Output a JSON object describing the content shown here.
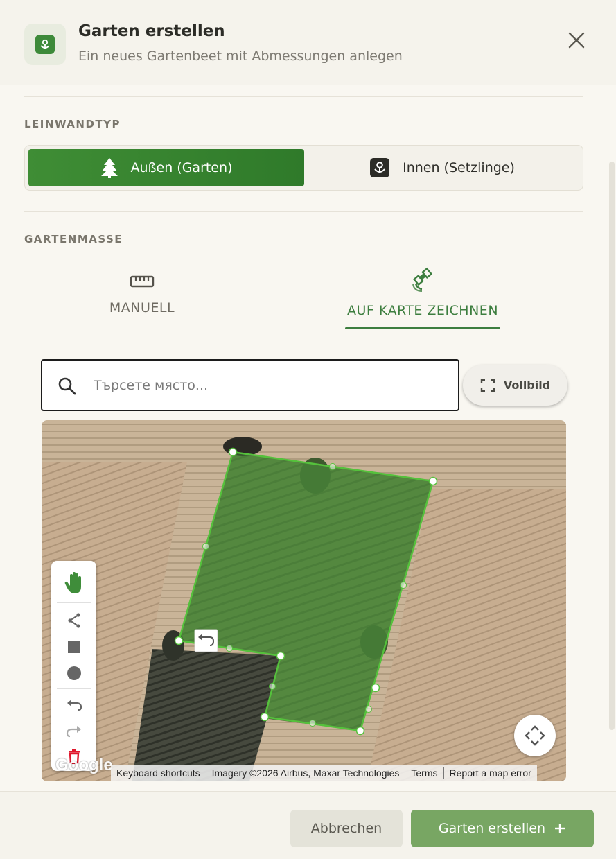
{
  "dialog": {
    "title": "Garten erstellen",
    "subtitle": "Ein neues Gartenbeet mit Abmessungen anlegen",
    "header_icon": "flower-icon",
    "close_icon": "close-icon"
  },
  "canvas_type": {
    "label": "LEINWANDTYP",
    "options": [
      {
        "label": "Außen (Garten)",
        "icon": "tree-icon",
        "selected": true
      },
      {
        "label": "Innen (Setzlinge)",
        "icon": "seedling-icon",
        "selected": false
      }
    ]
  },
  "dimensions": {
    "label": "GARTENMASSE",
    "tabs": [
      {
        "label": "MANUELL",
        "icon": "ruler-icon",
        "active": false
      },
      {
        "label": "AUF KARTE ZEICHNEN",
        "icon": "satellite-icon",
        "active": true
      }
    ]
  },
  "search": {
    "placeholder": "Търсете място...",
    "value": ""
  },
  "fullscreen": {
    "label": "Vollbild",
    "icon": "fullscreen-icon"
  },
  "map": {
    "tools": [
      "hand-icon",
      "polyline-icon",
      "rectangle-icon",
      "circle-icon",
      "undo-icon",
      "redo-icon",
      "delete-icon"
    ],
    "logo": "Google",
    "attribution": [
      "Keyboard shortcuts",
      "Imagery ©2026 Airbus, Maxar Technologies",
      "Terms",
      "Report a map error"
    ],
    "polygon_color": "#55c13c"
  },
  "footer": {
    "cancel_label": "Abbrechen",
    "create_label": "Garten erstellen",
    "create_icon": "plus-icon"
  },
  "colors": {
    "accent": "#3d8a3a",
    "primary_button": "#78a663",
    "background": "#f9f7f1"
  }
}
